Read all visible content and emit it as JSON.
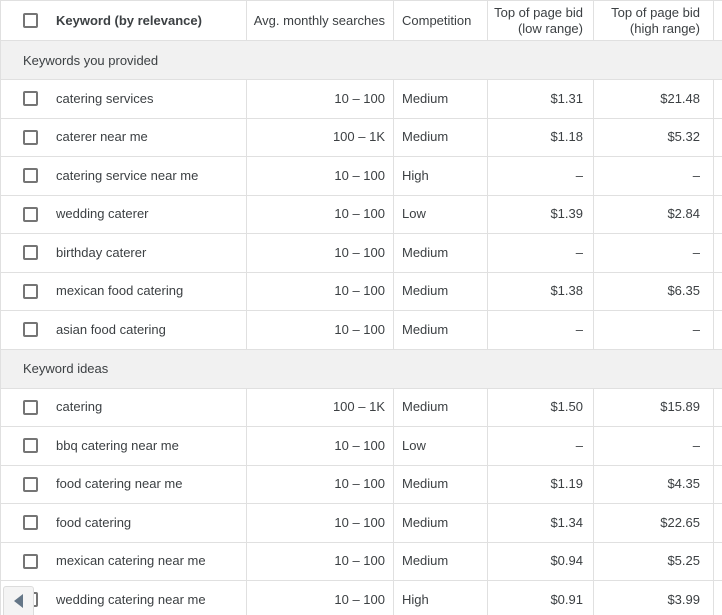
{
  "colors": {
    "border": "#e0e0e0",
    "section_background": "#f1f1f1",
    "text": "#3c4043",
    "checkbox_border": "#757575",
    "scroll_arrow": "#647687"
  },
  "table": {
    "columns": [
      {
        "label": "Keyword (by relevance)"
      },
      {
        "label": "Avg. monthly searches"
      },
      {
        "label": "Competition"
      },
      {
        "label": "Top of page bid (low range)"
      },
      {
        "label": "Top of page bid (high range)"
      }
    ],
    "sections": [
      {
        "label": "Keywords you provided",
        "rows": [
          {
            "keyword": "catering services",
            "searches": "10 – 100",
            "competition": "Medium",
            "low_bid": "$1.31",
            "high_bid": "$21.48"
          },
          {
            "keyword": "caterer near me",
            "searches": "100 – 1K",
            "competition": "Medium",
            "low_bid": "$1.18",
            "high_bid": "$5.32"
          },
          {
            "keyword": "catering service near me",
            "searches": "10 – 100",
            "competition": "High",
            "low_bid": "–",
            "high_bid": "–"
          },
          {
            "keyword": "wedding caterer",
            "searches": "10 – 100",
            "competition": "Low",
            "low_bid": "$1.39",
            "high_bid": "$2.84"
          },
          {
            "keyword": "birthday caterer",
            "searches": "10 – 100",
            "competition": "Medium",
            "low_bid": "–",
            "high_bid": "–"
          },
          {
            "keyword": "mexican food catering",
            "searches": "10 – 100",
            "competition": "Medium",
            "low_bid": "$1.38",
            "high_bid": "$6.35"
          },
          {
            "keyword": "asian food catering",
            "searches": "10 – 100",
            "competition": "Medium",
            "low_bid": "–",
            "high_bid": "–"
          }
        ]
      },
      {
        "label": "Keyword ideas",
        "rows": [
          {
            "keyword": "catering",
            "searches": "100 – 1K",
            "competition": "Medium",
            "low_bid": "$1.50",
            "high_bid": "$15.89"
          },
          {
            "keyword": "bbq catering near me",
            "searches": "10 – 100",
            "competition": "Low",
            "low_bid": "–",
            "high_bid": "–"
          },
          {
            "keyword": "food catering near me",
            "searches": "10 – 100",
            "competition": "Medium",
            "low_bid": "$1.19",
            "high_bid": "$4.35"
          },
          {
            "keyword": "food catering",
            "searches": "10 – 100",
            "competition": "Medium",
            "low_bid": "$1.34",
            "high_bid": "$22.65"
          },
          {
            "keyword": "mexican catering near me",
            "searches": "10 – 100",
            "competition": "Medium",
            "low_bid": "$0.94",
            "high_bid": "$5.25"
          },
          {
            "keyword": "wedding catering near me",
            "searches": "10 – 100",
            "competition": "High",
            "low_bid": "$0.91",
            "high_bid": "$3.99"
          }
        ]
      }
    ]
  }
}
